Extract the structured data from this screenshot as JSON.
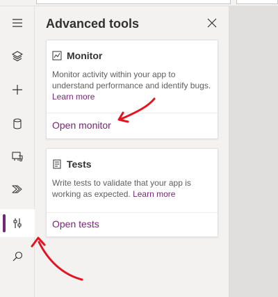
{
  "panel": {
    "title": "Advanced tools"
  },
  "monitor_card": {
    "icon": "monitor-chart-icon",
    "title": "Monitor",
    "description": "Monitor activity within your app to understand performance and identify bugs.",
    "learn_more": "Learn more",
    "action": "Open monitor"
  },
  "tests_card": {
    "icon": "tests-checklist-icon",
    "title": "Tests",
    "description": "Write tests to validate that your app is working as expected.",
    "learn_more": "Learn more",
    "action": "Open tests"
  },
  "rail": {
    "items": [
      "hamburger-menu-icon",
      "layers-icon",
      "plus-icon",
      "database-icon",
      "media-icon",
      "power-automate-icon",
      "advanced-tools-icon",
      "search-icon"
    ],
    "active": "advanced-tools-icon"
  },
  "colors": {
    "accent": "#742774",
    "annotation": "#e3141f",
    "rail_bg": "#f3f2f1",
    "canvas_bg": "#e1dfdd"
  }
}
